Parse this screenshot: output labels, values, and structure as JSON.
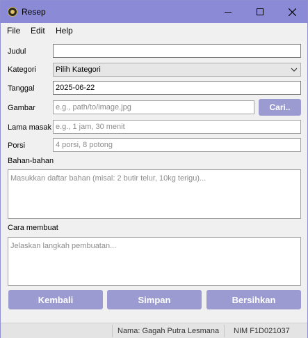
{
  "window": {
    "title": "Resep"
  },
  "menu": {
    "file": "File",
    "edit": "Edit",
    "help": "Help"
  },
  "form": {
    "judul": {
      "label": "Judul",
      "value": ""
    },
    "kategori": {
      "label": "Kategori",
      "selected": "Pilih Kategori"
    },
    "tanggal": {
      "label": "Tanggal",
      "value": "2025-06-22"
    },
    "gambar": {
      "label": "Gambar",
      "placeholder": "e.g., path/to/image.jpg",
      "browse_label": "Cari.."
    },
    "lama_masak": {
      "label": "Lama masak",
      "placeholder": "e.g., 1 jam, 30 menit"
    },
    "porsi": {
      "label": "Porsi",
      "placeholder": "4 porsi, 8 potong"
    },
    "bahan": {
      "label": "Bahan-bahan",
      "placeholder": "Masukkan daftar bahan (misal: 2 butir telur, 10kg terigu)..."
    },
    "cara": {
      "label": "Cara membuat",
      "placeholder": "Jelaskan langkah pembuatan..."
    }
  },
  "actions": {
    "back": "Kembali",
    "save": "Simpan",
    "clear": "Bersihkan"
  },
  "status": {
    "name": "Nama: Gagah Putra Lesmana",
    "nim": "NIM F1D021037"
  },
  "colors": {
    "titlebar": "#8a8ad6",
    "accent_button": "#9b9bd1"
  }
}
